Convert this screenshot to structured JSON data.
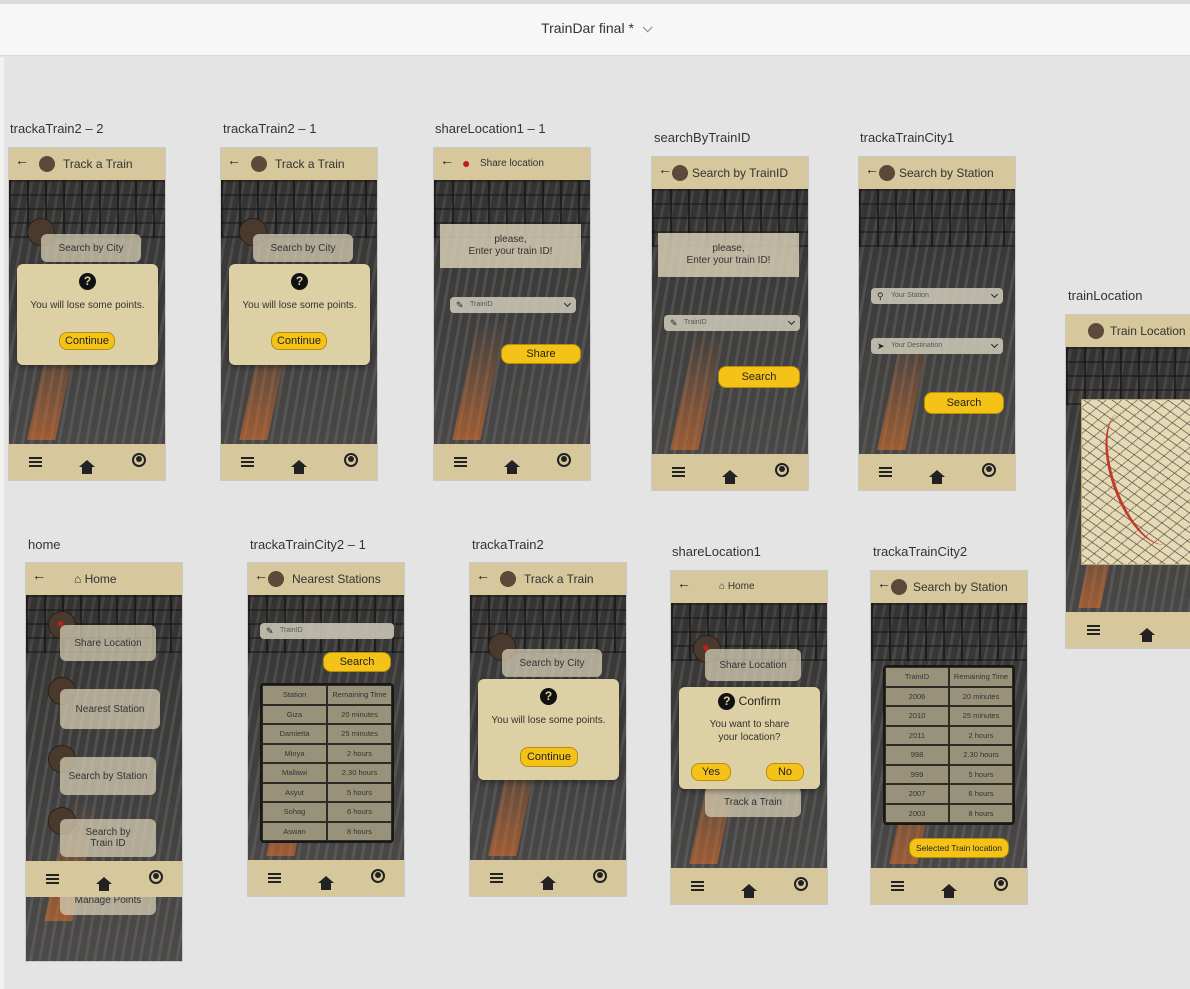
{
  "document": {
    "title": "TrainDar final *"
  },
  "common": {
    "back_arrow": "←",
    "continue": "Continue",
    "lose_points": "You will lose some points.",
    "search_by_city": "Search by City",
    "qmark": "?"
  },
  "artboards": {
    "tt22": {
      "label": "trackaTrain2 – 2",
      "title": "Track a Train"
    },
    "tt21": {
      "label": "trackaTrain2 – 1",
      "title": "Track a Train"
    },
    "sl11": {
      "label": "shareLocation1 – 1",
      "title": "Share location",
      "prompt_line1": "please,",
      "prompt_line2": "Enter your train ID!",
      "field_placeholder": "TrainID",
      "button": "Share"
    },
    "sbt": {
      "label": "searchByTrainID",
      "title": "Search by TrainID",
      "prompt_line1": "please,",
      "prompt_line2": "Enter your train ID!",
      "field_placeholder": "TrainID",
      "button": "Search"
    },
    "ttc1": {
      "label": "trackaTrainCity1",
      "title": "Search by Station",
      "station_placeholder": "Your Station",
      "destination_placeholder": "Your Destination",
      "button": "Search"
    },
    "tl": {
      "label": "trainLocation",
      "title": "Train Location"
    },
    "home": {
      "label": "home",
      "title": "Home",
      "items": [
        "Share Location",
        "Nearest Station",
        "Search by Station",
        "Search by Train ID",
        "Manage Points"
      ]
    },
    "ttc21": {
      "label": "trackaTrainCity2 – 1",
      "title": "Nearest Stations",
      "field_placeholder": "TrainID",
      "button": "Search",
      "headers": [
        "Station",
        "Remaining Time"
      ],
      "rows": [
        [
          "Giza",
          "20 minutes"
        ],
        [
          "Damietta",
          "25 minutes"
        ],
        [
          "Minya",
          "2 hours"
        ],
        [
          "Mallawi",
          "2.30 hours"
        ],
        [
          "Asyut",
          "5 hours"
        ],
        [
          "Sohag",
          "6 hours"
        ],
        [
          "Aswan",
          "8 hours"
        ]
      ]
    },
    "tt2": {
      "label": "trackaTrain2",
      "title": "Track a Train"
    },
    "sl1": {
      "label": "shareLocation1",
      "title": "Home",
      "share_item": "Share Location",
      "track_item": "Track a Train",
      "confirm_title": "Confirm",
      "confirm_text_line1": "You want to share",
      "confirm_text_line2": "your location?",
      "yes": "Yes",
      "no": "No"
    },
    "ttc2": {
      "label": "trackaTrainCity2",
      "title": "Search by Station",
      "headers": [
        "TrainID",
        "Remaining Time"
      ],
      "rows": [
        [
          "2006",
          "20 minutes"
        ],
        [
          "2010",
          "25 minutes"
        ],
        [
          "2011",
          "2 hours"
        ],
        [
          "998",
          "2.30 hours"
        ],
        [
          "999",
          "5 hours"
        ],
        [
          "2007",
          "6 hours"
        ],
        [
          "2003",
          "8 hours"
        ]
      ],
      "button": "Selected Train location"
    }
  },
  "colors": {
    "header": "#d6c79c",
    "accent": "#f5c318",
    "dialog": "#ddd0a5",
    "pin": "#cc1b1b"
  }
}
